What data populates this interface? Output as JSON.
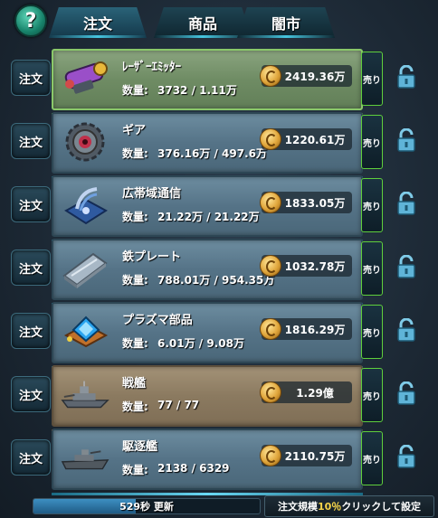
{
  "header": {
    "help_label": "?",
    "tabs": [
      {
        "label": "注文",
        "active": true
      },
      {
        "label": "商品",
        "active": false
      },
      {
        "label": "闇市",
        "active": false
      }
    ]
  },
  "order_button_label": "注文",
  "qty_label": "数量:",
  "sell_label": "売り",
  "items": [
    {
      "name": "ﾚｰｻﾞｰｴﾐｯﾀｰ",
      "qty": "3732 / 1.11万",
      "price": "2419.36万",
      "style": "green",
      "icon": "laser-emitter-icon"
    },
    {
      "name": "ギア",
      "qty": "376.16万 / 497.6万",
      "price": "1220.61万",
      "style": "blue",
      "icon": "gear-icon"
    },
    {
      "name": "広帯域通信",
      "qty": "21.22万 / 21.22万",
      "price": "1833.05万",
      "style": "blue",
      "icon": "broadband-comm-icon"
    },
    {
      "name": "鉄プレート",
      "qty": "788.01万 / 954.35万",
      "price": "1032.78万",
      "style": "blue",
      "icon": "iron-plate-icon"
    },
    {
      "name": "プラズマ部品",
      "qty": "6.01万 / 9.08万",
      "price": "1816.29万",
      "style": "blue",
      "icon": "plasma-part-icon"
    },
    {
      "name": "戦艦",
      "qty": "77 / 77",
      "price": "1.29億",
      "style": "tan",
      "icon": "battleship-icon"
    },
    {
      "name": "駆逐艦",
      "qty": "2138 / 6329",
      "price": "2110.75万",
      "style": "blue",
      "icon": "destroyer-icon"
    }
  ],
  "footer": {
    "progress_text": "529秒 更新",
    "progress_fraction": 0.45,
    "scale_prefix": "注文規模",
    "scale_pct": "10％",
    "scale_suffix": "クリックして設定"
  },
  "colors": {
    "sell_border": "#5fcf3c",
    "price_box": "#1c2830",
    "progress_fill": "#3d8fc2",
    "scale_highlight": "#f5d44a"
  }
}
